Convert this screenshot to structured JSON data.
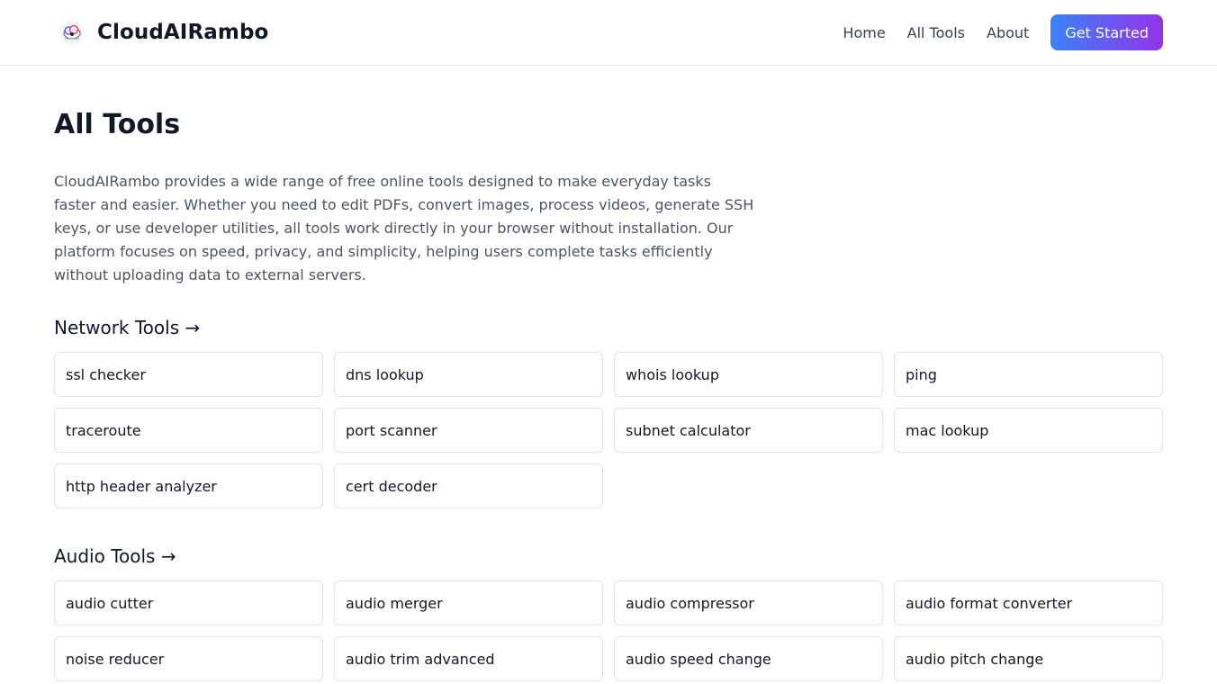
{
  "header": {
    "brand_name": "CloudAIRambo",
    "logo_icon": "cloud-logo-icon",
    "nav": [
      {
        "label": "Home"
      },
      {
        "label": "All Tools"
      },
      {
        "label": "About"
      }
    ],
    "cta_label": "Get Started"
  },
  "main": {
    "title": "All Tools",
    "intro": "CloudAIRambo provides a wide range of free online tools designed to make everyday tasks faster and easier. Whether you need to edit PDFs, convert images, process videos, generate SSH keys, or use developer utilities, all tools work directly in your browser without installation. Our platform focuses on speed, privacy, and simplicity, helping users complete tasks efficiently without uploading data to external servers.",
    "sections": [
      {
        "title": "Network Tools →",
        "tools": [
          "ssl checker",
          "dns lookup",
          "whois lookup",
          "ping",
          "traceroute",
          "port scanner",
          "subnet calculator",
          "mac lookup",
          "http header analyzer",
          "cert decoder"
        ]
      },
      {
        "title": "Audio Tools →",
        "tools": [
          "audio cutter",
          "audio merger",
          "audio compressor",
          "audio format converter",
          "noise reducer",
          "audio trim advanced",
          "audio speed change",
          "audio pitch change"
        ]
      }
    ]
  },
  "colors": {
    "accent_start": "#3b82f6",
    "accent_end": "#9333ea",
    "text_primary": "#111827",
    "text_muted": "#4b5563",
    "card_border": "#dfe2e7"
  }
}
